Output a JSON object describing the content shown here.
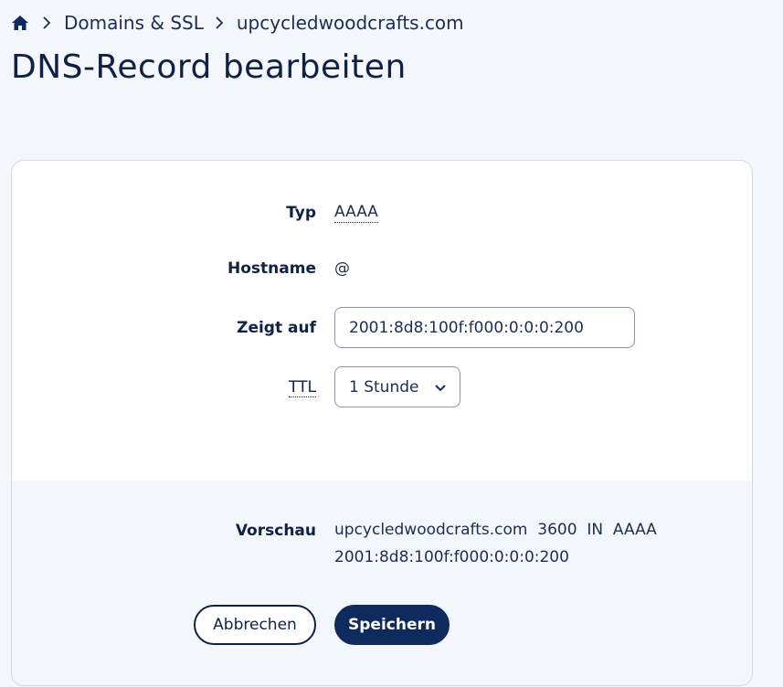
{
  "breadcrumb": {
    "home_icon": "home-icon",
    "items": [
      "Domains & SSL",
      "upcycledwoodcrafts.com"
    ]
  },
  "page_title": "DNS-Record bearbeiten",
  "form": {
    "type_label": "Typ",
    "type_value": "AAAA",
    "hostname_label": "Hostname",
    "hostname_value": "@",
    "points_to_label": "Zeigt auf",
    "points_to_value": "2001:8d8:100f:f000:0:0:0:200",
    "ttl_label": "TTL",
    "ttl_value": "1 Stunde"
  },
  "preview": {
    "label": "Vorschau",
    "line1": "upcycledwoodcrafts.com  3600  IN  AAAA",
    "line2": "2001:8d8:100f:f000:0:0:0:200"
  },
  "buttons": {
    "cancel": "Abbrechen",
    "save": "Speichern"
  },
  "colors": {
    "primary": "#0f2a5c",
    "background": "#f3f6fa"
  }
}
